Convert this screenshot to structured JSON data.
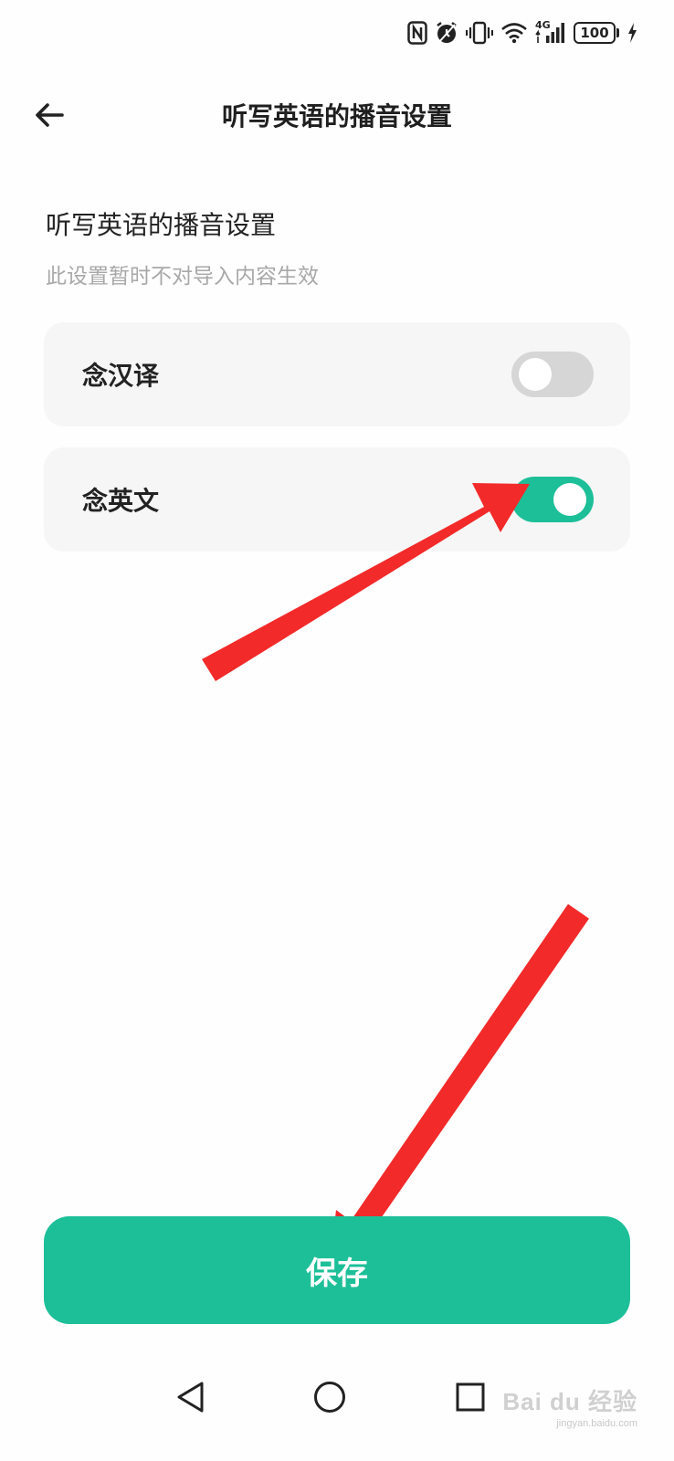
{
  "status_bar": {
    "network_label": "4G",
    "battery_level": "100",
    "icons": [
      "nfc-icon",
      "alarm-icon",
      "vibrate-icon",
      "wifi-icon",
      "signal-icon",
      "battery-icon",
      "charging-icon"
    ]
  },
  "header": {
    "title": "听写英语的播音设置",
    "back_icon": "arrow-left-icon"
  },
  "section": {
    "title": "听写英语的播音设置",
    "subtitle": "此设置暂时不对导入内容生效"
  },
  "settings": [
    {
      "label": "念汉译",
      "enabled": false
    },
    {
      "label": "念英文",
      "enabled": true
    }
  ],
  "save_label": "保存",
  "colors": {
    "accent": "#1dbf98",
    "toggle_off": "#d6d6d6",
    "card_bg": "#f6f6f6",
    "annotation_arrow": "#f22a2a"
  },
  "nav_bar": {
    "icons": [
      "back-triangle-icon",
      "home-circle-icon",
      "recents-square-icon"
    ]
  },
  "watermark": {
    "text": "Bai du 经验",
    "sub": "jingyan.baidu.com"
  }
}
